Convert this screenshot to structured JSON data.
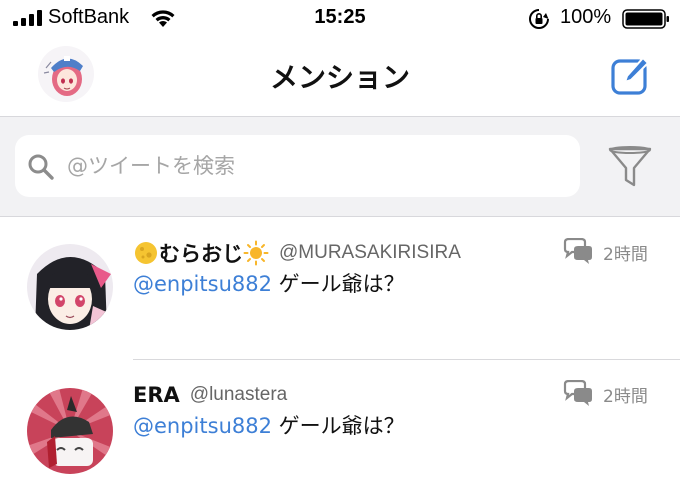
{
  "status_bar": {
    "carrier": "SoftBank",
    "time": "15:25",
    "battery": "100%"
  },
  "nav": {
    "title": "メンション",
    "avatar_icon": "user-avatar-icon",
    "compose_icon": "compose-icon"
  },
  "search": {
    "placeholder": "@ツイートを検索",
    "filter_icon": "filter-funnel-icon"
  },
  "tweets": [
    {
      "display_name": "むらおじ",
      "handle": "@MURASAKIRISIRA",
      "time": "2時間",
      "mention": "@enpitsu882",
      "text": " ゲール爺は？"
    },
    {
      "display_name": "ERA",
      "handle": "@lunastera",
      "time": "2時間",
      "mention": "@enpitsu882",
      "text": " ゲール爺は？"
    }
  ],
  "colors": {
    "accent": "#3d7fd6",
    "search_bg": "#f2f2f4",
    "secondary_text": "#8a8a8a"
  }
}
